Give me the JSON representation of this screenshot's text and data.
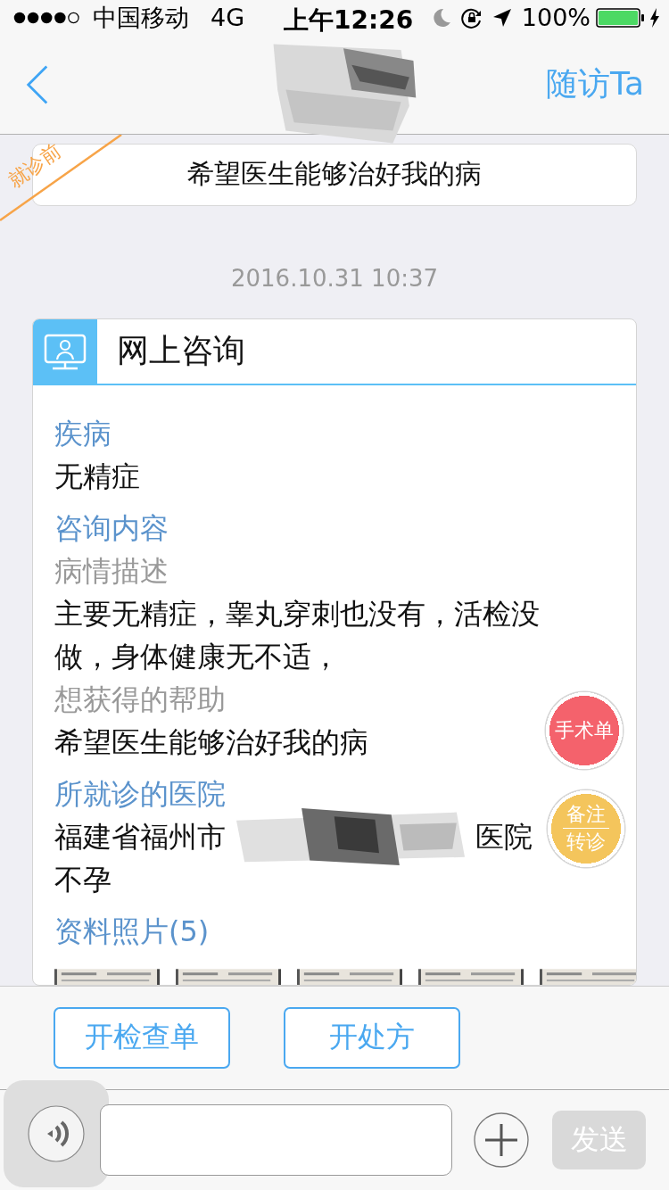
{
  "status_bar": {
    "carrier": "中国移动",
    "network": "4G",
    "time": "上午12:26",
    "battery": "100%"
  },
  "nav": {
    "action": "随访Ta"
  },
  "pre_visit": {
    "tag": "就诊前",
    "text": "希望医生能够治好我的病"
  },
  "timestamp": "2016.10.31 10:37",
  "consultation": {
    "title": "网上咨询",
    "sections": [
      {
        "kind": "heading",
        "text": "疾病"
      },
      {
        "kind": "value",
        "text": "无精症"
      },
      {
        "kind": "heading",
        "text": "咨询内容"
      },
      {
        "kind": "subheading",
        "text": "病情描述"
      },
      {
        "kind": "value",
        "text": "主要无精症，睾丸穿刺也没有，活检没做，身体健康无不适，"
      },
      {
        "kind": "subheading",
        "text": "想获得的帮助"
      },
      {
        "kind": "value",
        "text": "希望医生能够治好我的病"
      },
      {
        "kind": "heading",
        "text": "所就诊的医院"
      },
      {
        "kind": "redacted",
        "before": "福建省福州市",
        "after": "医院"
      },
      {
        "kind": "value",
        "text": "不孕"
      },
      {
        "kind": "heading",
        "text": "资料照片(5)"
      }
    ]
  },
  "floating_buttons": [
    {
      "kind": "single",
      "text": "手术单",
      "color": "#f4626c"
    },
    {
      "kind": "split",
      "lines": [
        "备注",
        "转诊"
      ],
      "color": "#f4c55c"
    }
  ],
  "actions": [
    "开检查单",
    "开处方"
  ],
  "composer": {
    "send": "发送"
  }
}
